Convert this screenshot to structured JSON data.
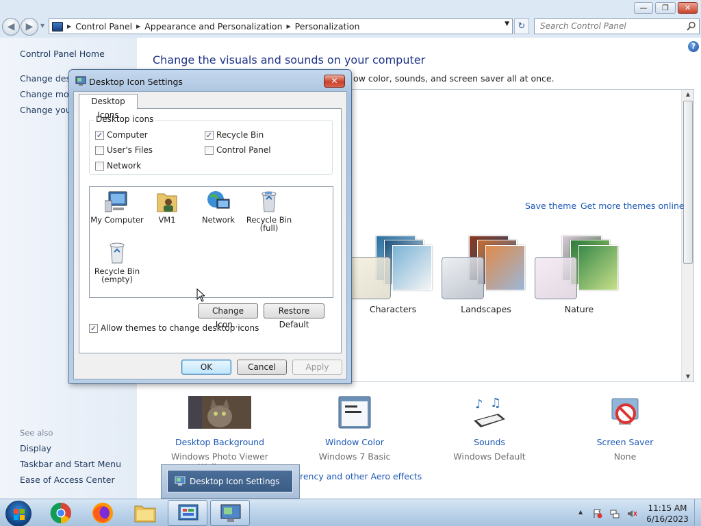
{
  "window": {
    "minimize_glyph": "—",
    "restore_glyph": "❐",
    "close_glyph": "✕"
  },
  "address": {
    "crumbs": [
      "Control Panel",
      "Appearance and Personalization",
      "Personalization"
    ],
    "search_placeholder": "Search Control Panel",
    "back_glyph": "◀",
    "forward_glyph": "▶",
    "dropdown_glyph": "▼",
    "refresh_glyph": "↻"
  },
  "left_pane": {
    "home": "Control Panel Home",
    "links": [
      "Change deskt",
      "Change mous",
      "Change your"
    ],
    "see_also_label": "See also",
    "see_also": [
      "Display",
      "Taskbar and Start Menu",
      "Ease of Access Center"
    ]
  },
  "main": {
    "heading": "Change the visuals and sounds on your computer",
    "description_tail": "ow color, sounds, and screen saver all at once.",
    "save_theme": "Save theme",
    "get_more_themes": "Get more themes online",
    "themes": [
      "Characters",
      "Landscapes",
      "Nature"
    ],
    "bottom": [
      {
        "label": "Desktop Background",
        "sub": "Windows Photo Viewer Wallpaper",
        "icon": "desktop-background-icon"
      },
      {
        "label": "Window Color",
        "sub": "Windows 7 Basic",
        "icon": "window-color-icon"
      },
      {
        "label": "Sounds",
        "sub": "Windows Default",
        "icon": "sounds-icon"
      },
      {
        "label": "Screen Saver",
        "sub": "None",
        "icon": "screen-saver-icon"
      }
    ],
    "aero_link": "rency and other Aero effects"
  },
  "dialog": {
    "title": "Desktop Icon Settings",
    "close_glyph": "✕",
    "tab": "Desktop Icons",
    "group_label": "Desktop icons",
    "checkboxes": [
      {
        "label": "Computer",
        "checked": true
      },
      {
        "label": "Recycle Bin",
        "checked": true
      },
      {
        "label": "User's Files",
        "checked": false
      },
      {
        "label": "Control Panel",
        "checked": false
      },
      {
        "label": "Network",
        "checked": false
      }
    ],
    "icons": [
      {
        "line1": "My Computer",
        "line2": "",
        "icon": "computer-icon"
      },
      {
        "line1": "VM1",
        "line2": "",
        "icon": "user-folder-icon"
      },
      {
        "line1": "Network",
        "line2": "",
        "icon": "network-icon"
      },
      {
        "line1": "Recycle Bin",
        "line2": "(full)",
        "icon": "recycle-bin-full-icon"
      },
      {
        "line1": "Recycle Bin",
        "line2": "(empty)",
        "icon": "recycle-bin-empty-icon"
      }
    ],
    "change_icon_btn": "Change Icon...",
    "restore_default_btn": "Restore Default",
    "allow_themes_label": "Allow themes to change desktop icons",
    "allow_themes_checked": true,
    "ok_btn": "OK",
    "cancel_btn": "Cancel",
    "apply_btn": "Apply",
    "check_glyph": "✓"
  },
  "taskbar_preview": {
    "label": "Desktop Icon Settings"
  },
  "taskbar": {
    "time": "11:15 AM",
    "date": "6/16/2023",
    "tray_up_glyph": "▲",
    "pinned": [
      "chrome-icon",
      "firefox-icon",
      "file-explorer-icon",
      "control-panel-icon",
      "desktop-icon-settings-icon"
    ]
  },
  "help_glyph": "?",
  "search_glyph": "⌕"
}
